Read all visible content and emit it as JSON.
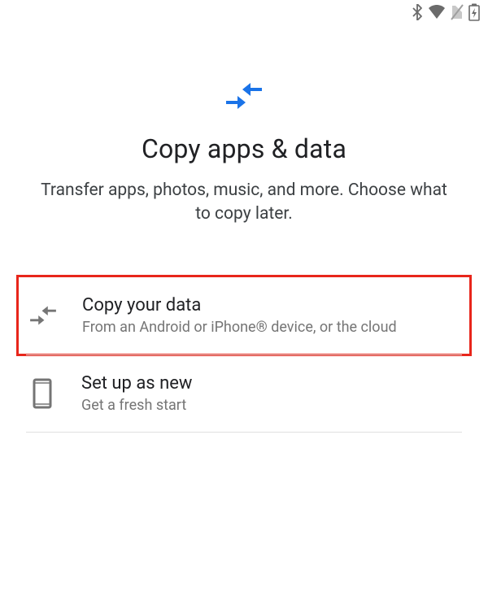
{
  "colors": {
    "accent_blue": "#1a73e8",
    "highlight_red": "#e8261b",
    "text_primary": "#202124",
    "text_secondary": "#757575"
  },
  "hero": {
    "title": "Copy apps & data",
    "subtitle": "Transfer apps, photos, music, and more. Choose what to copy later."
  },
  "options": [
    {
      "title": "Copy your data",
      "desc": "From an Android or iPhone® device, or the cloud",
      "highlighted": true
    },
    {
      "title": "Set up as new",
      "desc": "Get a fresh start",
      "highlighted": false
    }
  ]
}
